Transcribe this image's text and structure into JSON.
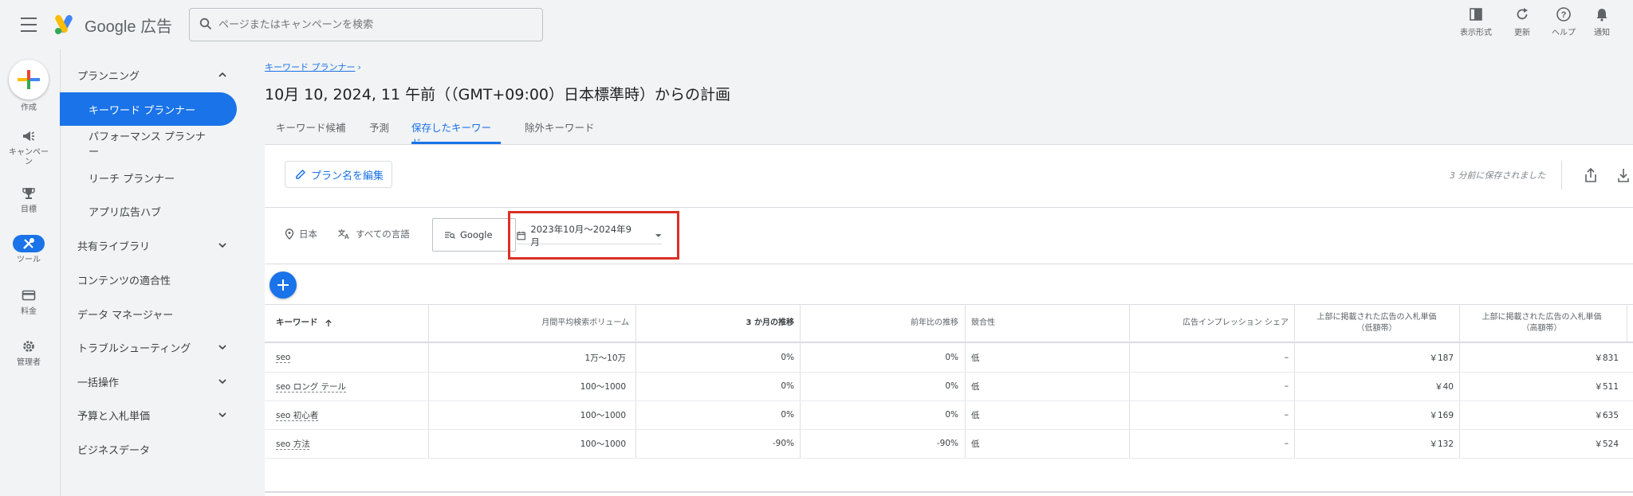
{
  "header": {
    "brand_google": "Google",
    "brand_ads": "広告",
    "search_placeholder": "ページまたはキャンペーンを検索",
    "tools": [
      {
        "label": "表示形式",
        "icon": "view-mode-icon"
      },
      {
        "label": "更新",
        "icon": "refresh-icon"
      },
      {
        "label": "ヘルプ",
        "icon": "help-icon"
      },
      {
        "label": "通知",
        "icon": "bell-icon"
      }
    ]
  },
  "rail": {
    "create": "作成",
    "items": [
      {
        "label": "キャンペーン",
        "icon": "campaign-icon"
      },
      {
        "label": "目標",
        "icon": "trophy-icon"
      },
      {
        "label": "ツール",
        "icon": "tools-icon",
        "active": true
      },
      {
        "label": "料金",
        "icon": "billing-icon"
      },
      {
        "label": "管理者",
        "icon": "admin-gear-icon"
      }
    ]
  },
  "sidenav": {
    "planning": "プランニング",
    "keyword_planner": "キーワード プランナー",
    "performance_planner_line1": "パフォーマンス プランナ",
    "performance_planner_line2": "ー",
    "reach_planner": "リーチ プランナー",
    "app_hub": "アプリ広告ハブ",
    "shared_library": "共有ライブラリ",
    "content_suitability": "コンテンツの適合性",
    "data_manager": "データ マネージャー",
    "troubleshooting": "トラブルシューティング",
    "bulk_actions": "一括操作",
    "budget_bidding": "予算と入札単価",
    "business_data": "ビジネスデータ"
  },
  "main": {
    "breadcrumb": "キーワード プランナー",
    "title": "10月 10, 2024, 11 午前（（GMT+09:00）日本標準時）からの計画",
    "tabs": [
      "キーワード候補",
      "予測",
      "保存したキーワード",
      "除外キーワード"
    ],
    "active_tab": "保存したキーワード",
    "rename_button": "プラン名を編集",
    "saved_status": "3 分前に保存されました",
    "filters": {
      "location": "日本",
      "language": "すべての言語",
      "network": "Google",
      "date_range": "2023年10月～2024年9月"
    }
  },
  "table": {
    "headers": {
      "keyword": "キーワード",
      "volume": "月間平均検索ボリューム",
      "three_month": "3 か月の推移",
      "yoy": "前年比の推移",
      "competition": "競合性",
      "impression_share": "広告インプレッション シェア",
      "bid_low_1": "上部に掲載された広告の入札単価",
      "bid_low_2": "（低額帯）",
      "bid_high_1": "上部に掲載された広告の入札単価",
      "bid_high_2": "（高額帯）"
    },
    "rows": [
      {
        "keyword": "seo",
        "volume": "1万～10万",
        "three_month": "0%",
        "yoy": "0%",
        "competition": "低",
        "impression_share": "–",
        "bid_low": "￥187",
        "bid_high": "￥831"
      },
      {
        "keyword": "seo ロング テール",
        "volume": "100～1000",
        "three_month": "0%",
        "yoy": "0%",
        "competition": "低",
        "impression_share": "–",
        "bid_low": "￥40",
        "bid_high": "￥511"
      },
      {
        "keyword": "seo 初心者",
        "volume": "100～1000",
        "three_month": "0%",
        "yoy": "0%",
        "competition": "低",
        "impression_share": "–",
        "bid_low": "￥169",
        "bid_high": "￥635"
      },
      {
        "keyword": "seo 方法",
        "volume": "100～1000",
        "three_month": "-90%",
        "yoy": "-90%",
        "competition": "低",
        "impression_share": "–",
        "bid_low": "￥132",
        "bid_high": "￥524"
      }
    ]
  },
  "colors": {
    "accent": "#1a73e8",
    "highlight": "#d93025",
    "background": "#f1f3f4"
  }
}
